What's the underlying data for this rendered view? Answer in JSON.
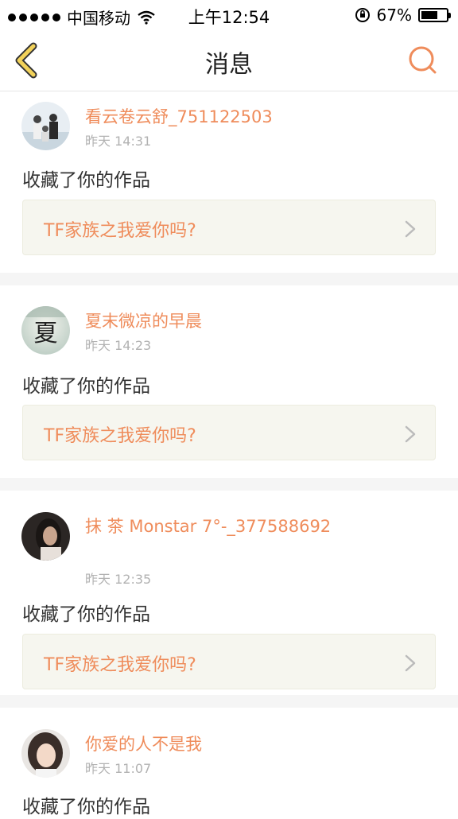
{
  "status_bar": {
    "carrier": "中国移动",
    "time": "上午12:54",
    "battery_percent_text": "67%",
    "battery_level": 0.67
  },
  "nav": {
    "title": "消息"
  },
  "messages": [
    {
      "name": "看云卷云舒_751122503",
      "time": "昨天 14:31",
      "action": "收藏了你的作品",
      "card": "TF家族之我爱你吗?"
    },
    {
      "name": "夏末微凉的早晨",
      "time": "昨天 14:23",
      "action": "收藏了你的作品",
      "card": "TF家族之我爱你吗?",
      "avatar_char": "夏"
    },
    {
      "name": "抹 茶 Monstar 7°-_377588692",
      "time": "昨天 12:35",
      "action": "收藏了你的作品",
      "card": "TF家族之我爱你吗?"
    },
    {
      "name": "你爱的人不是我",
      "time": "昨天 11:07",
      "action": "收藏了你的作品"
    }
  ],
  "colors": {
    "accent": "#ef8c5b",
    "back_icon": "#f2c94c",
    "card_bg": "#f6f6ef"
  }
}
